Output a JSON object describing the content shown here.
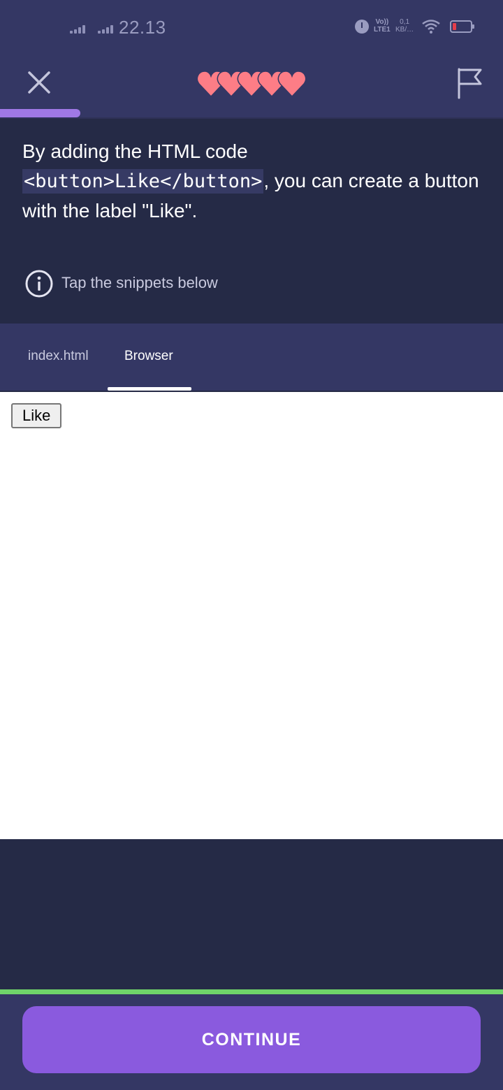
{
  "status_bar": {
    "time": "22.13",
    "volte_line1": "Vo))",
    "volte_line2": "LTE1",
    "net_speed_value": "0,1",
    "net_speed_unit": "KB/…",
    "battery_state": "low"
  },
  "header": {
    "close_icon": "close-icon",
    "lives": 5,
    "heart_color": "#fd7d86",
    "flag_icon": "flag-icon",
    "progress": 0.16
  },
  "lesson": {
    "text_before": "By adding the HTML code ",
    "code": "<button>Like</button>",
    "text_after": ", you can create a button with the label \"Like\".",
    "hint": "Tap the snippets below"
  },
  "tabs": [
    {
      "label": "index.html",
      "active": false
    },
    {
      "label": "Browser",
      "active": true
    }
  ],
  "browser_preview": {
    "button_label": "Like"
  },
  "footer": {
    "continue_label": "CONTINUE"
  },
  "colors": {
    "background": "#252a46",
    "panel": "#343764",
    "accent": "#8a5ade",
    "success": "#6fd36a"
  }
}
